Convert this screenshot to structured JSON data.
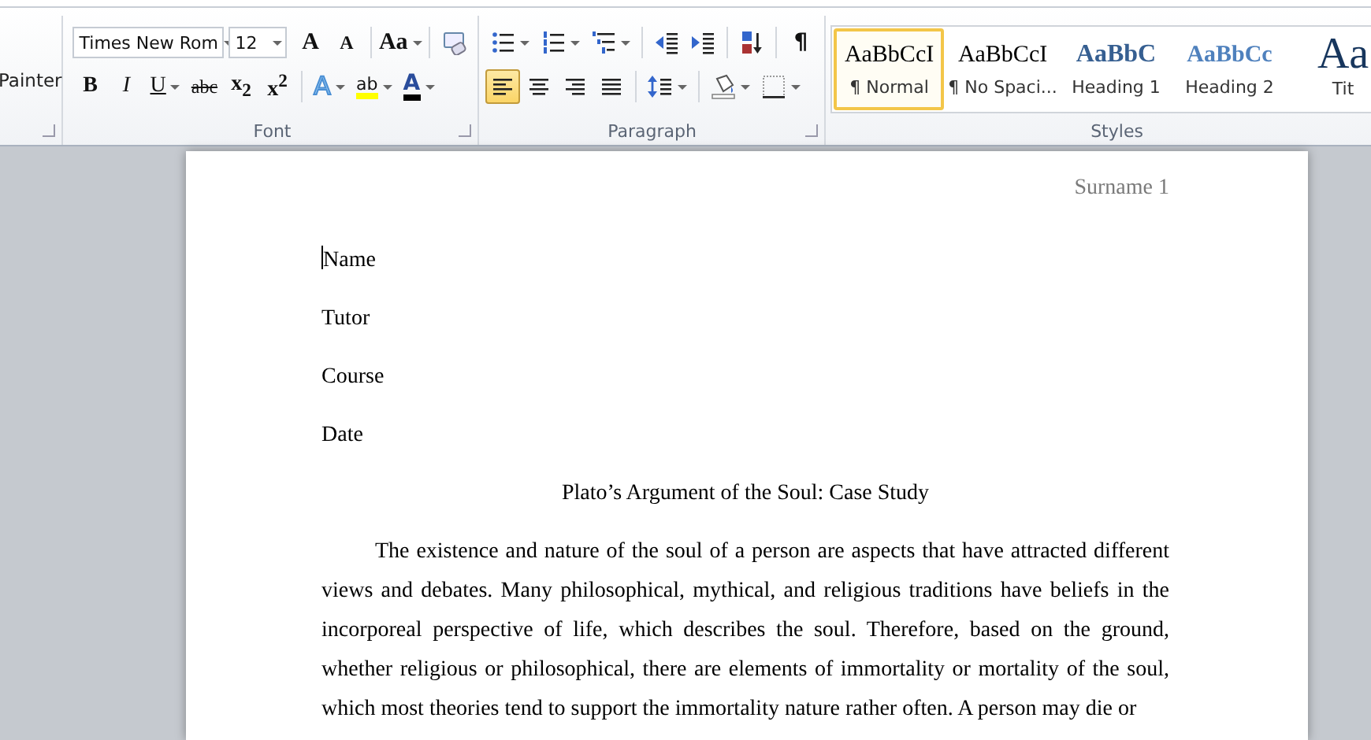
{
  "ribbon": {
    "clipboard": {
      "partial_label": "Painter"
    },
    "font": {
      "label": "Font",
      "font_name": "Times New Rom",
      "font_size": "12",
      "row1": [
        {
          "kind": "grow",
          "label": "A",
          "has_menu": false
        },
        {
          "kind": "shrink",
          "label": "A",
          "has_menu": false
        },
        {
          "kind": "sep"
        },
        {
          "kind": "case",
          "label": "Aa",
          "has_menu": true
        },
        {
          "kind": "sep"
        },
        {
          "kind": "clear",
          "has_menu": false
        }
      ],
      "row2": [
        {
          "kind": "bold",
          "label": "B",
          "has_menu": false
        },
        {
          "kind": "italic",
          "label": "I",
          "has_menu": false
        },
        {
          "kind": "underline",
          "label": "U",
          "has_menu": true
        },
        {
          "kind": "strike",
          "label": "abc",
          "has_menu": false
        },
        {
          "kind": "sub",
          "label": "x$_{2}$",
          "has_menu": false
        },
        {
          "kind": "sup",
          "label": "x$^{2}$",
          "has_menu": false
        },
        {
          "kind": "sep"
        },
        {
          "kind": "effect",
          "label": "A",
          "has_menu": true
        },
        {
          "kind": "highlight",
          "label": "ab",
          "has_menu": true
        },
        {
          "kind": "color",
          "label": "A",
          "has_menu": true
        }
      ]
    },
    "paragraph": {
      "label": "Paragraph",
      "row1": [
        {
          "kind": "bullets",
          "has_menu": true,
          "selected": false
        },
        {
          "kind": "numbering",
          "has_menu": true,
          "selected": false
        },
        {
          "kind": "multilevel",
          "has_menu": true,
          "selected": false
        },
        {
          "kind": "sep"
        },
        {
          "kind": "outdent",
          "has_menu": false,
          "selected": false
        },
        {
          "kind": "indent",
          "has_menu": false,
          "selected": false
        },
        {
          "kind": "sep"
        },
        {
          "kind": "sort",
          "has_menu": false,
          "selected": false
        },
        {
          "kind": "sep"
        },
        {
          "kind": "pilcrow",
          "label": "¶",
          "has_menu": false,
          "selected": false
        }
      ],
      "row2": [
        {
          "kind": "align-left",
          "has_menu": false,
          "selected": true
        },
        {
          "kind": "align-center",
          "has_menu": false,
          "selected": false
        },
        {
          "kind": "align-right",
          "has_menu": false,
          "selected": false
        },
        {
          "kind": "justify",
          "has_menu": false,
          "selected": false
        },
        {
          "kind": "sep"
        },
        {
          "kind": "spacing",
          "has_menu": true,
          "selected": false
        },
        {
          "kind": "sep"
        },
        {
          "kind": "shading",
          "has_menu": true,
          "selected": false
        },
        {
          "kind": "borders",
          "has_menu": true,
          "selected": false
        }
      ]
    },
    "styles": {
      "label": "Styles",
      "items": [
        {
          "kind": "normal",
          "preview": "AaBbCcI",
          "name": "¶ Normal",
          "selected": true
        },
        {
          "kind": "normal",
          "preview": "AaBbCcI",
          "name": "¶ No Spaci...",
          "selected": false
        },
        {
          "kind": "heading1",
          "preview": "AaBbC",
          "name": "Heading 1",
          "selected": false
        },
        {
          "kind": "heading2",
          "preview": "AaBbCc",
          "name": "Heading 2",
          "selected": false
        },
        {
          "kind": "title",
          "preview": "Aa",
          "name": "Tit",
          "selected": false
        }
      ]
    }
  },
  "document": {
    "header": "Surname 1",
    "lines": [
      "Name",
      "Tutor",
      "Course",
      "Date"
    ],
    "title": "Plato’s Argument of the Soul: Case Study",
    "paragraph": "The existence and nature of the soul of a person are aspects that have attracted different views and debates. Many philosophical, mythical, and religious traditions have beliefs in the incorporeal perspective of life, which describes the soul. Therefore, based on the ground, whether religious or philosophical, there are elements of immortality or mortality of the soul, which most theories tend to support the immortality nature rather often. A person may die or"
  }
}
